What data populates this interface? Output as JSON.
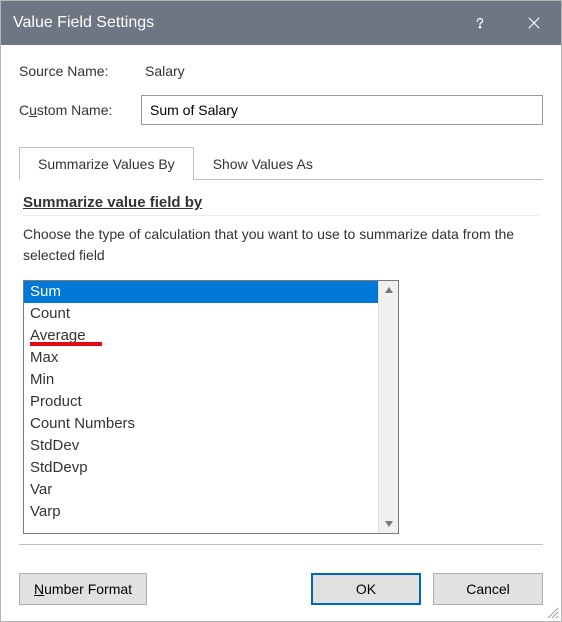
{
  "titlebar": {
    "title": "Value Field Settings"
  },
  "source": {
    "label": "Source Name:",
    "value": "Salary"
  },
  "custom": {
    "label_before": "C",
    "label_underline": "u",
    "label_after": "stom Name:",
    "value": "Sum of Salary"
  },
  "tabs": {
    "summarize": "Summarize Values By",
    "show": "Show Values As"
  },
  "section": {
    "title_underline": "S",
    "title_after": "ummarize value field by",
    "instruction": "Choose the type of calculation that you want to use to summarize data from the selected field"
  },
  "list": {
    "items": [
      "Sum",
      "Count",
      "Average",
      "Max",
      "Min",
      "Product",
      "Count Numbers",
      "StdDev",
      "StdDevp",
      "Var",
      "Varp"
    ],
    "selected_index": 0
  },
  "footer": {
    "number_format_u": "N",
    "number_format_after": "umber Format",
    "ok": "OK",
    "cancel": "Cancel"
  }
}
